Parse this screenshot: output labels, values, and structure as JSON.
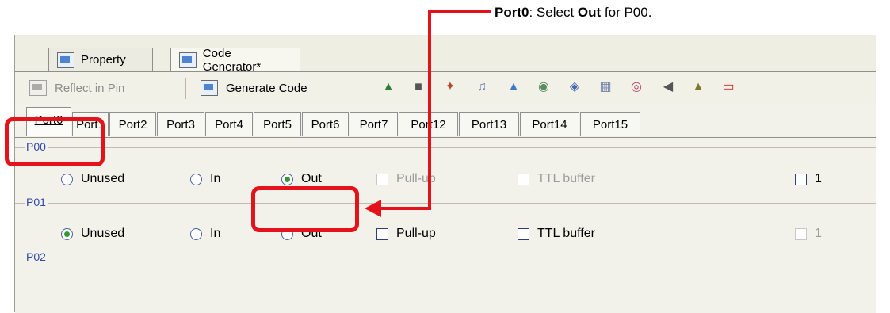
{
  "callout": {
    "part1": "Port0",
    "part2": ": Select ",
    "part3": "Out",
    "part4": " for P00."
  },
  "view_tabs": {
    "property": "Property",
    "code_generator": "Code Generator*"
  },
  "toolbar": {
    "reflect_in_pin": "Reflect in Pin",
    "generate_code": "Generate Code"
  },
  "port_tabs": [
    "Port0",
    "Port1",
    "Port2",
    "Port3",
    "Port4",
    "Port5",
    "Port6",
    "Port7",
    "Port12",
    "Port13",
    "Port14",
    "Port15"
  ],
  "groups": [
    {
      "title": "P00",
      "unused": "Unused",
      "in": "In",
      "out": "Out",
      "pullup": "Pull-up",
      "ttl": "TTL buffer",
      "value": "1"
    },
    {
      "title": "P01",
      "unused": "Unused",
      "in": "In",
      "out": "Out",
      "pullup": "Pull-up",
      "ttl": "TTL buffer",
      "value": "1"
    },
    {
      "title": "P02"
    }
  ],
  "colors": {
    "highlight": "#e4121a",
    "group_title": "#2f49a5"
  }
}
